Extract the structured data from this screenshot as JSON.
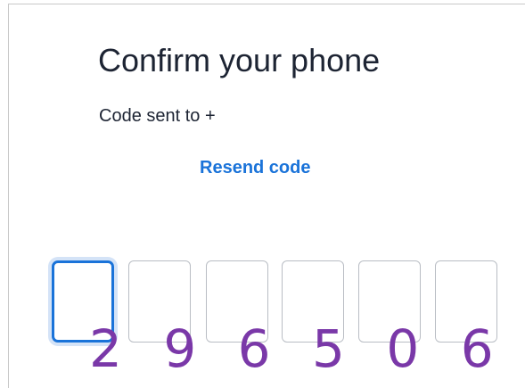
{
  "header": {
    "title": "Confirm your phone",
    "subtitle": "Code sent to +"
  },
  "actions": {
    "resend_label": "Resend code"
  },
  "otp": {
    "box_count": 6,
    "active_index": 0,
    "overlay_code": "2 9 6 5 0 6"
  },
  "colors": {
    "accent": "#1a73d9",
    "text": "#1d2433",
    "box_border": "#b9bdc4",
    "overlay_code": "#7a38a8"
  }
}
